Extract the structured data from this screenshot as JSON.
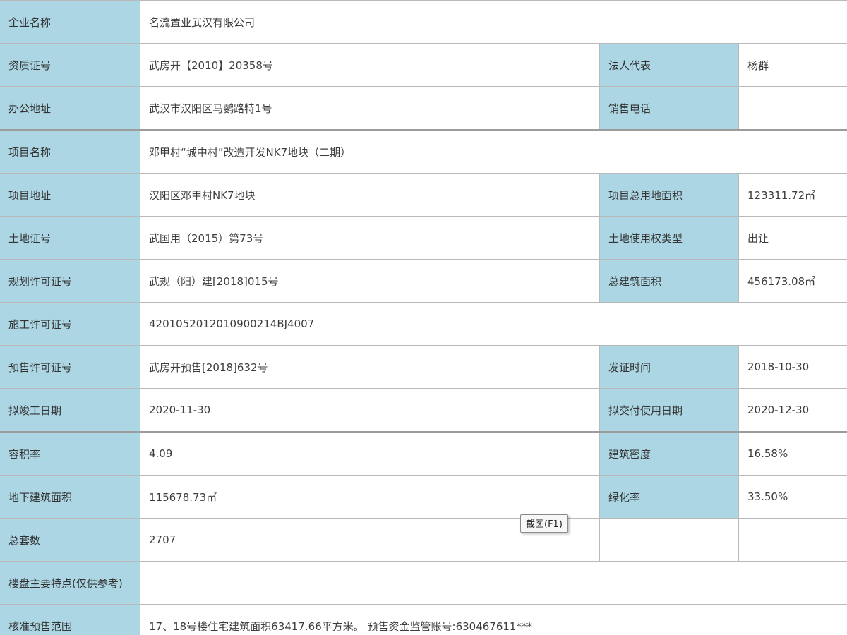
{
  "rows": [
    {
      "label": "企业名称",
      "value": "名流置业武汉有限公司"
    },
    {
      "label": "资质证号",
      "value": "武房开【2010】20358号",
      "label2": "法人代表",
      "value2": "杨群"
    },
    {
      "label": "办公地址",
      "value": "武汉市汉阳区马鹦路特1号",
      "label2": "销售电话",
      "value2": ""
    },
    {
      "label": "项目名称",
      "value": "邓甲村“城中村”改造开发NK7地块（二期）"
    },
    {
      "label": "项目地址",
      "value": "汉阳区邓甲村NK7地块",
      "label2": "项目总用地面积",
      "value2": "123311.72㎡"
    },
    {
      "label": "土地证号",
      "value": "武国用（2015）第73号",
      "label2": "土地使用权类型",
      "value2": "出让"
    },
    {
      "label": "规划许可证号",
      "value": "武规（阳）建[2018]015号",
      "label2": "总建筑面积",
      "value2": "456173.08㎡"
    },
    {
      "label": "施工许可证号",
      "value": "4201052012010900214BJ4007"
    },
    {
      "label": "预售许可证号",
      "value": "武房开预售[2018]632号",
      "label2": "发证时间",
      "value2": "2018-10-30"
    },
    {
      "label": "拟竣工日期",
      "value": "2020-11-30",
      "label2": "拟交付使用日期",
      "value2": "2020-12-30"
    },
    {
      "label": "容积率",
      "value": "4.09",
      "label2": "建筑密度",
      "value2": "16.58%"
    },
    {
      "label": "地下建筑面积",
      "value": "115678.73㎡",
      "label2": "绿化率",
      "value2": "33.50%"
    },
    {
      "label": "总套数",
      "value": "2707",
      "label2": "",
      "value2": ""
    },
    {
      "label": "楼盘主要特点(仅供参考)",
      "value": ""
    },
    {
      "label": "核准预售范围",
      "value": "17、18号楼住宅建筑面积63417.66平方米。 预售资金监管账号:630467611***"
    }
  ],
  "tooltip": "截图(F1)",
  "colors": {
    "label_bg": "#acd6e4",
    "value_bg": "#ffffff",
    "border": "#b9b9b9"
  }
}
